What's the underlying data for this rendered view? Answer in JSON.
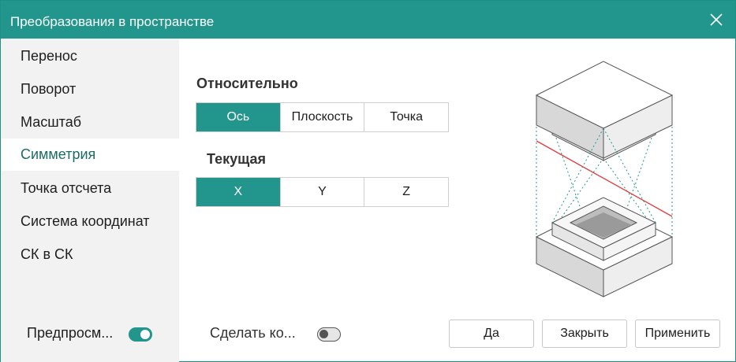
{
  "window": {
    "title": "Преобразования в пространстве"
  },
  "sidebar": {
    "items": [
      {
        "label": "Перенос"
      },
      {
        "label": "Поворот"
      },
      {
        "label": "Масштаб"
      },
      {
        "label": "Симметрия",
        "active": true
      },
      {
        "label": "Точка отсчета"
      },
      {
        "label": "Система координат"
      },
      {
        "label": "СК в СК"
      }
    ],
    "preview": {
      "label": "Предпросм...",
      "on": true
    }
  },
  "relative": {
    "label": "Относительно",
    "options": [
      "Ось",
      "Плоскость",
      "Точка"
    ],
    "selected": "Ось"
  },
  "current": {
    "label": "Текущая",
    "options": [
      "X",
      "Y",
      "Z"
    ],
    "selected": "X"
  },
  "footer": {
    "make_copy": {
      "label": "Сделать ко...",
      "on": false
    },
    "buttons": {
      "yes": "Да",
      "close": "Закрыть",
      "apply": "Применить"
    }
  },
  "colors": {
    "accent": "#22968c",
    "mirror_plane": "#e03c3c"
  },
  "icons": {
    "close": "close-icon",
    "illustration": "mirror-symmetry-illustration"
  }
}
